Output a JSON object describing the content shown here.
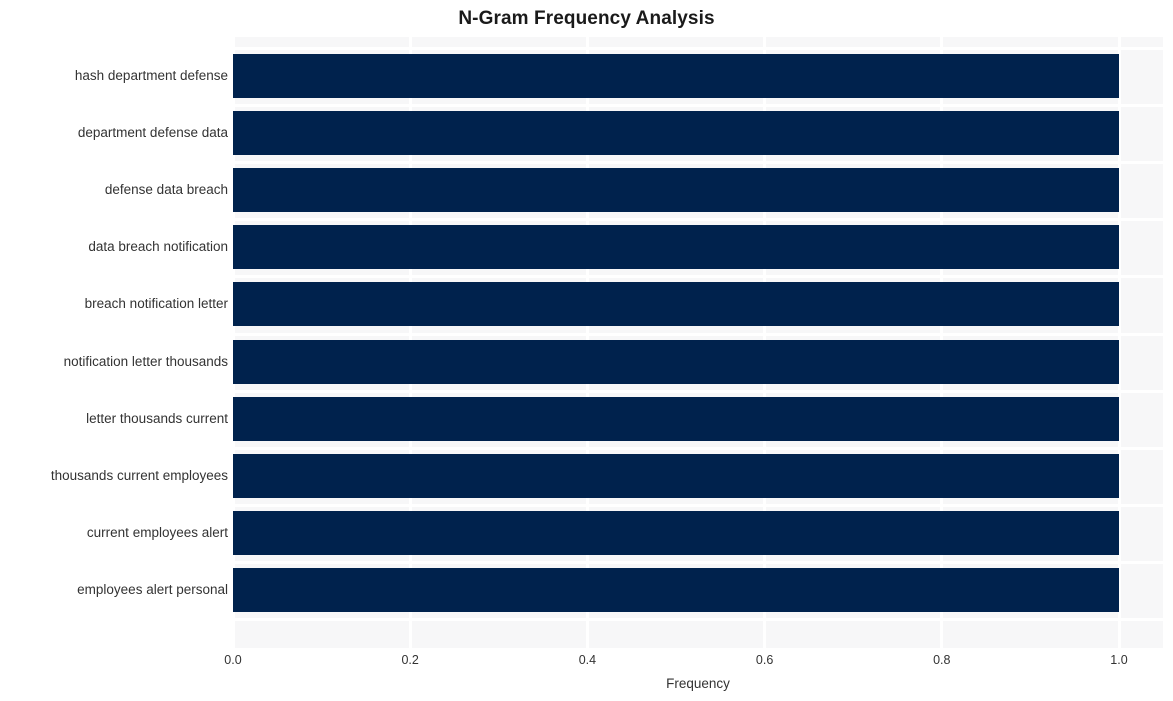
{
  "chart_data": {
    "type": "bar",
    "orientation": "horizontal",
    "title": "N-Gram Frequency Analysis",
    "xlabel": "Frequency",
    "ylabel": "",
    "categories": [
      "hash department defense",
      "department defense data",
      "defense data breach",
      "data breach notification",
      "breach notification letter",
      "notification letter thousands",
      "letter thousands current",
      "thousands current employees",
      "current employees alert",
      "employees alert personal"
    ],
    "values": [
      1.0,
      1.0,
      1.0,
      1.0,
      1.0,
      1.0,
      1.0,
      1.0,
      1.0,
      1.0
    ],
    "xlim": [
      0.0,
      1.05
    ],
    "xticks": [
      "0.0",
      "0.2",
      "0.4",
      "0.6",
      "0.8",
      "1.0"
    ],
    "xtick_values": [
      0.0,
      0.2,
      0.4,
      0.6,
      0.8,
      1.0
    ],
    "grid": true,
    "legend": false,
    "colors": {
      "bar": "#00224d",
      "plot_background": "#f7f7f8",
      "gridline": "#ffffff",
      "page_background": "#ffffff",
      "title_text": "#1a1a1a",
      "tick_text": "#333333"
    }
  }
}
